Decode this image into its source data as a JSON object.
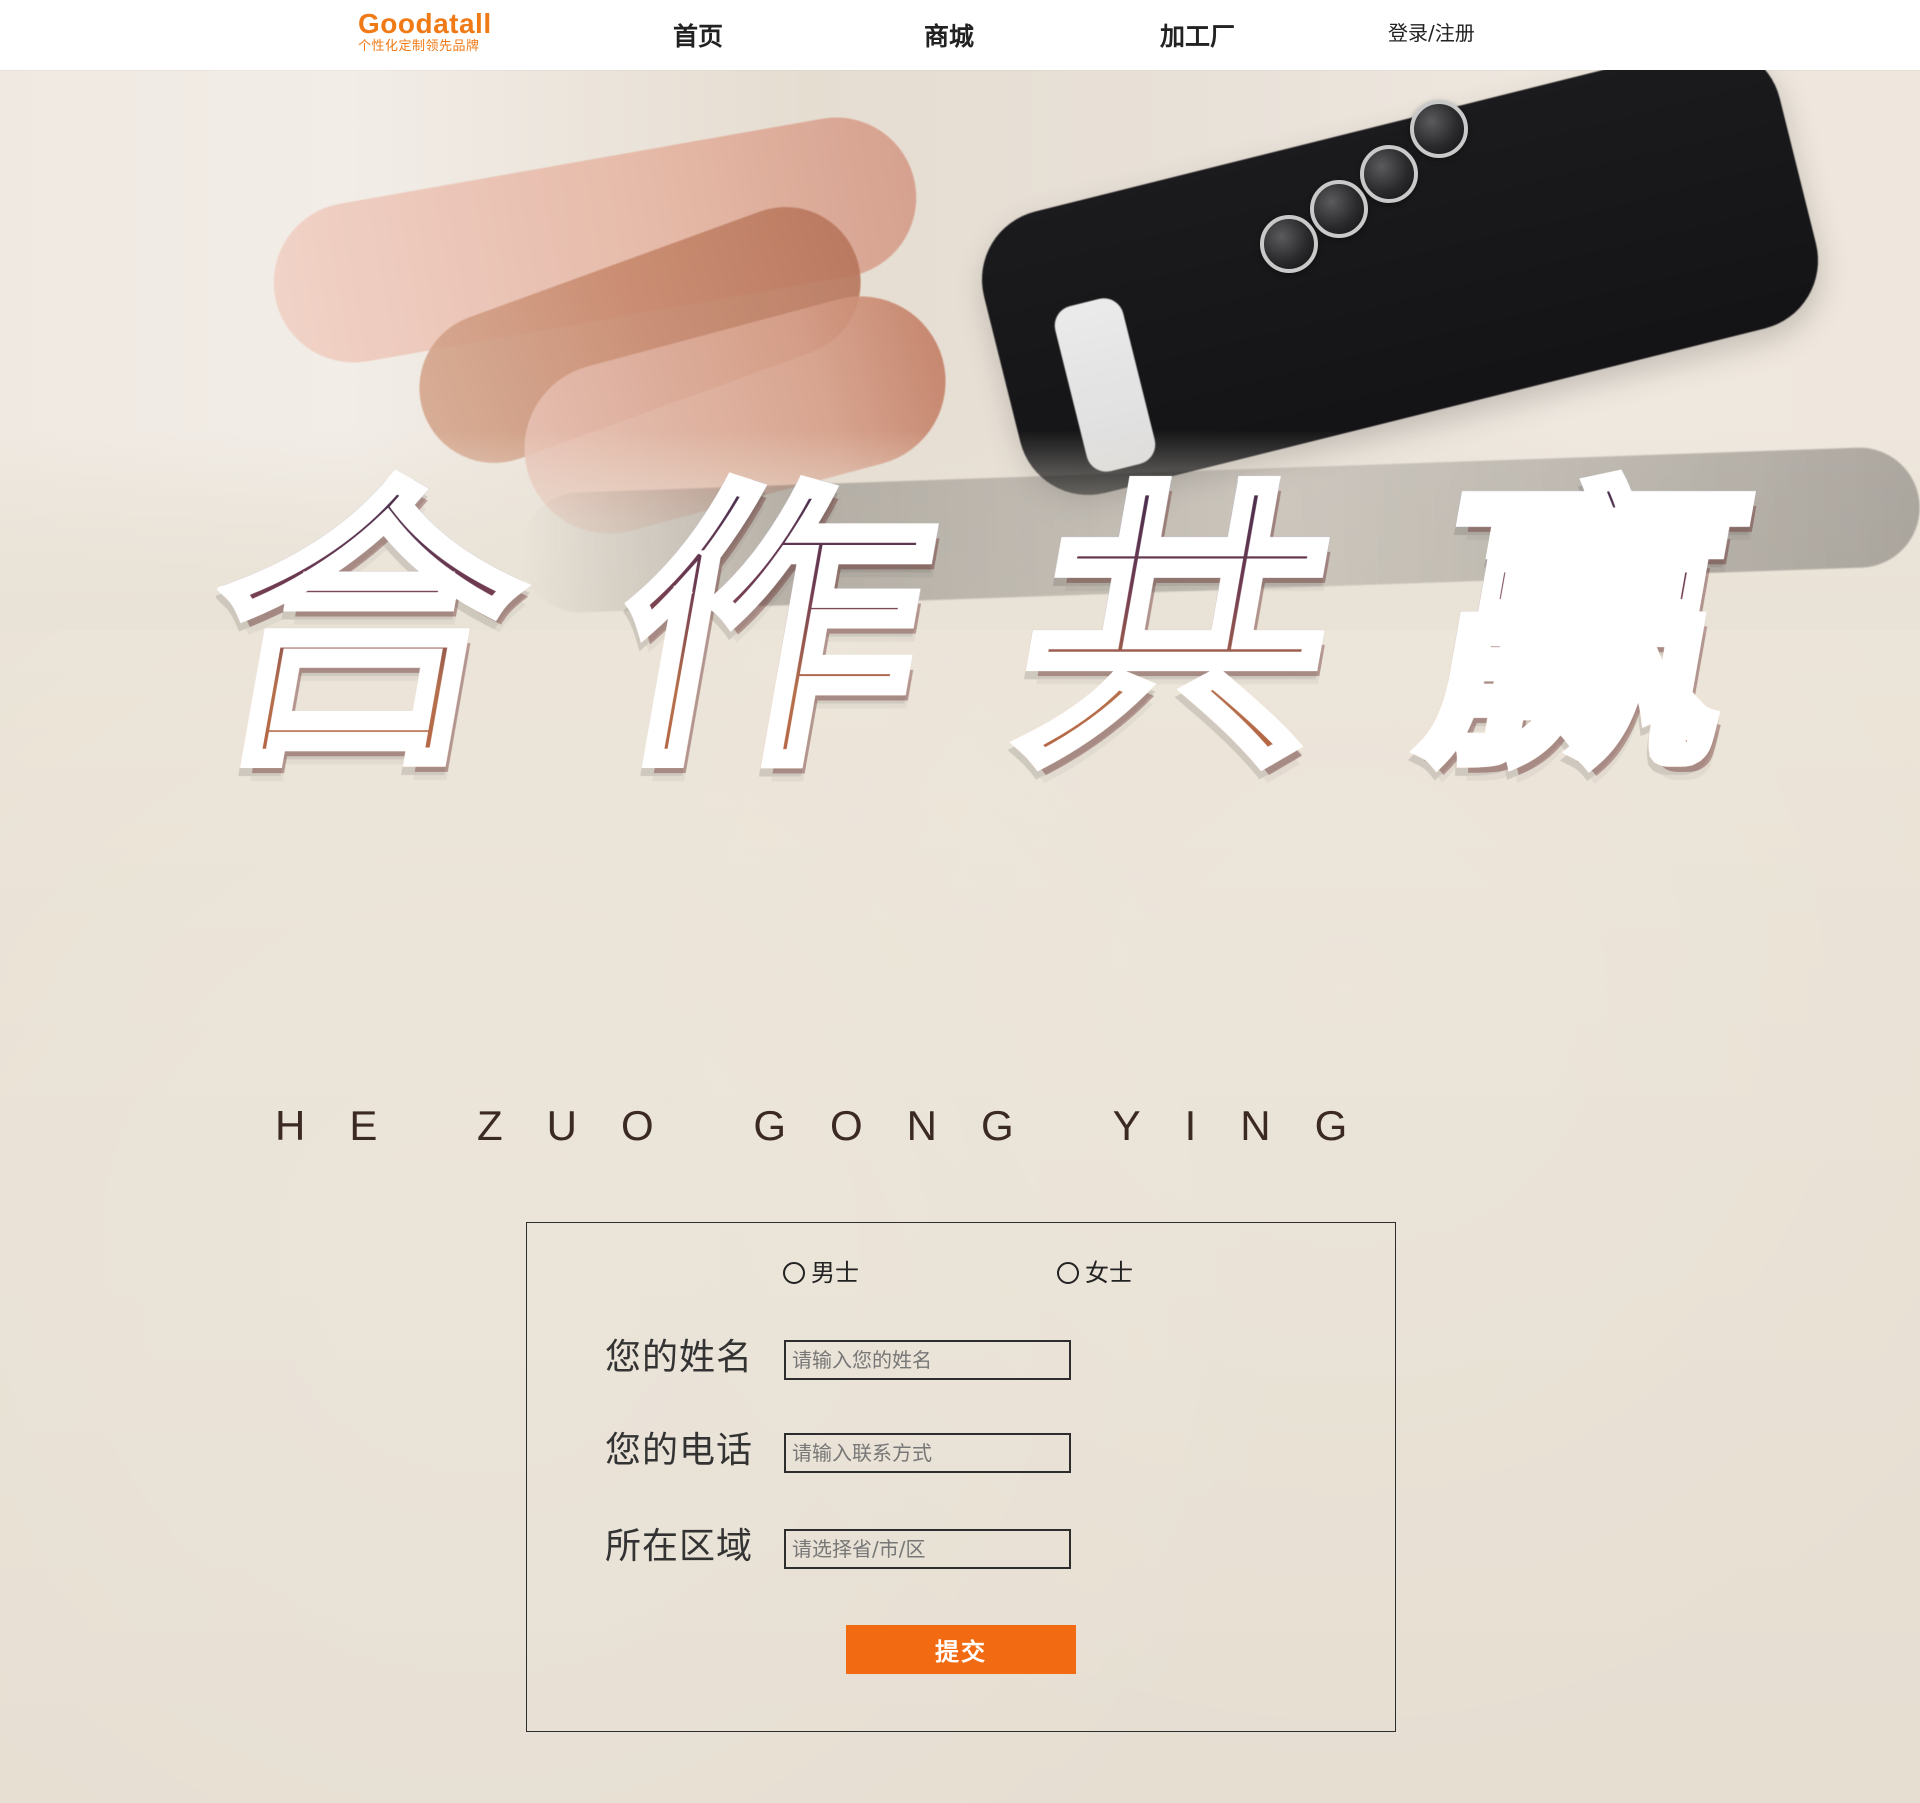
{
  "nav": {
    "logo_brand": "Goodatall",
    "logo_slogan": "个性化定制领先品牌",
    "links": [
      "首页",
      "商城",
      "加工厂"
    ],
    "auth": "登录/注册"
  },
  "hero": {
    "title_chars": [
      "合",
      "作",
      "共",
      "赢"
    ],
    "pinyin": "HE ZUO GONG YING"
  },
  "form": {
    "gender": {
      "male": "男士",
      "female": "女士"
    },
    "fields": {
      "name": {
        "label": "您的姓名",
        "placeholder": "请输入您的姓名"
      },
      "phone": {
        "label": "您的电话",
        "placeholder": "请输入联系方式"
      },
      "region": {
        "label": "所在区域",
        "placeholder": "请选择省/市/区"
      }
    },
    "submit": "提交"
  },
  "colors": {
    "accent": "#f26a12",
    "logo": "#f07a16"
  }
}
